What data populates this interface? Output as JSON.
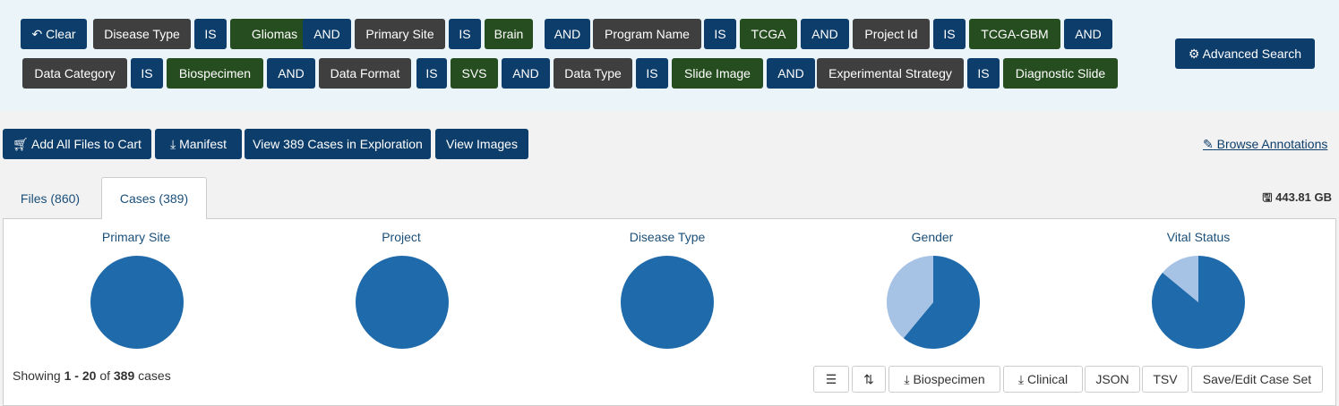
{
  "query": {
    "clear_label": "Clear",
    "row1": [
      {
        "label": "Disease Type",
        "kind": "field"
      },
      {
        "label": "IS",
        "kind": "op"
      },
      {
        "label": "Gliomas",
        "kind": "value"
      },
      {
        "label": "AND",
        "kind": "op"
      },
      {
        "label": "Primary Site",
        "kind": "field"
      },
      {
        "label": "IS",
        "kind": "op"
      },
      {
        "label": "Brain",
        "kind": "value"
      },
      {
        "label": "AND",
        "kind": "op"
      },
      {
        "label": "Program Name",
        "kind": "field"
      },
      {
        "label": "IS",
        "kind": "op"
      },
      {
        "label": "TCGA",
        "kind": "value"
      },
      {
        "label": "AND",
        "kind": "op"
      },
      {
        "label": "Project Id",
        "kind": "field"
      },
      {
        "label": "IS",
        "kind": "op"
      },
      {
        "label": "TCGA-GBM",
        "kind": "value"
      },
      {
        "label": "AND",
        "kind": "op"
      }
    ],
    "row2": [
      {
        "label": "Data Category",
        "kind": "field"
      },
      {
        "label": "IS",
        "kind": "op"
      },
      {
        "label": "Biospecimen",
        "kind": "value"
      },
      {
        "label": "AND",
        "kind": "op"
      },
      {
        "label": "Data Format",
        "kind": "field"
      },
      {
        "label": "IS",
        "kind": "op"
      },
      {
        "label": "SVS",
        "kind": "value"
      },
      {
        "label": "AND",
        "kind": "op"
      },
      {
        "label": "Data Type",
        "kind": "field"
      },
      {
        "label": "IS",
        "kind": "op"
      },
      {
        "label": "Slide Image",
        "kind": "value"
      },
      {
        "label": "AND",
        "kind": "op"
      },
      {
        "label": "Experimental Strategy",
        "kind": "field"
      },
      {
        "label": "IS",
        "kind": "op"
      },
      {
        "label": "Diagnostic Slide",
        "kind": "value"
      }
    ],
    "advanced_label": "Advanced Search"
  },
  "actions": {
    "add_all": "Add All Files to Cart",
    "manifest": "Manifest",
    "view_cases": "View 389 Cases in Exploration",
    "view_images": "View Images",
    "browse_annotations": "Browse Annotations"
  },
  "tabs": {
    "files": "Files (860)",
    "cases": "Cases (389)"
  },
  "total_size": "443.81 GB",
  "pies": [
    {
      "title": "Primary Site",
      "slices": [
        1.0
      ]
    },
    {
      "title": "Project",
      "slices": [
        1.0
      ]
    },
    {
      "title": "Disease Type",
      "slices": [
        1.0
      ]
    },
    {
      "title": "Gender",
      "slices": [
        0.61,
        0.39
      ]
    },
    {
      "title": "Vital Status",
      "slices": [
        0.86,
        0.14
      ]
    }
  ],
  "colors": {
    "pie_main": "#1f6aab",
    "pie_light": "#a6c2e4",
    "chip_field": "#3f3f3f",
    "chip_op": "#0d3d6b",
    "chip_value": "#264d1f"
  },
  "footer": {
    "showing_prefix": "Showing",
    "range_start": "1",
    "dash": "-",
    "range_end": "20",
    "of": "of",
    "total": "389",
    "unit": "cases",
    "biospecimen": "Biospecimen",
    "clinical": "Clinical",
    "json": "JSON",
    "tsv": "TSV",
    "save_case_set": "Save/Edit Case Set"
  }
}
